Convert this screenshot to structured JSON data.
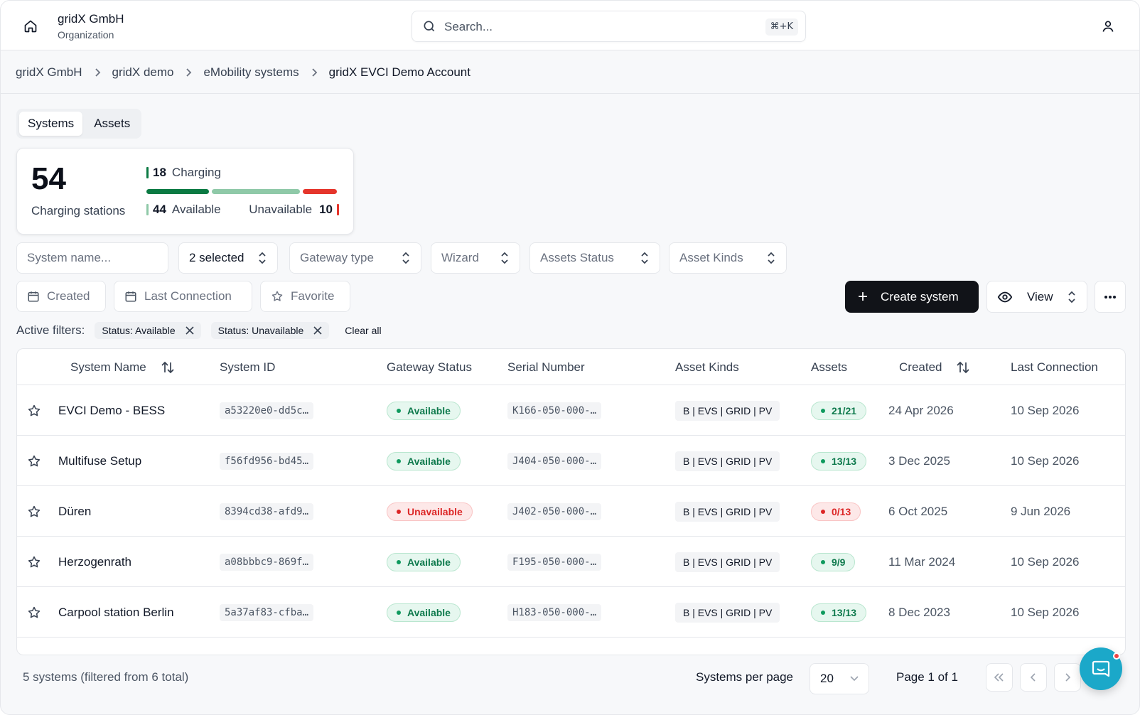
{
  "header": {
    "org_name": "gridX GmbH",
    "org_sub": "Organization",
    "search_placeholder": "Search...",
    "search_shortcut": "⌘+K"
  },
  "breadcrumb": [
    "gridX GmbH",
    "gridX demo",
    "eMobility systems",
    "gridX EVCI Demo Account"
  ],
  "tabs": [
    {
      "label": "Systems",
      "active": true
    },
    {
      "label": "Assets",
      "active": false
    }
  ],
  "stats": {
    "total": "54",
    "total_label": "Charging stations",
    "charging_count": "18",
    "charging_label": "Charging",
    "available_count": "44",
    "available_label": "Available",
    "unavailable_label": "Unavailable",
    "unavailable_count": "10",
    "colors": {
      "charging": "#0b7a43",
      "available": "#8fc9a8",
      "unavailable": "#e5352b"
    }
  },
  "filters": {
    "system_name_placeholder": "System name...",
    "status": "2 selected",
    "gateway_type": "Gateway type",
    "wizard": "Wizard",
    "assets_status": "Assets Status",
    "asset_kinds": "Asset Kinds",
    "created": "Created",
    "last_connection": "Last Connection",
    "favorite": "Favorite"
  },
  "actions": {
    "create_label": "Create system",
    "view_label": "View"
  },
  "active_filters": {
    "label": "Active filters:",
    "chips": [
      "Status: Available",
      "Status: Unavailable"
    ],
    "clear_all": "Clear all"
  },
  "table": {
    "columns": {
      "system_name": "System Name",
      "system_id": "System ID",
      "gateway_status": "Gateway Status",
      "serial_number": "Serial Number",
      "asset_kinds": "Asset Kinds",
      "assets": "Assets",
      "created": "Created",
      "last_connection": "Last Connection"
    },
    "rows": [
      {
        "name": "EVCI Demo - BESS",
        "id": "a53220e0-dd5c…",
        "status": "Available",
        "status_ok": true,
        "serial": "K166-050-000-…",
        "kinds": "B | EVS | GRID | PV",
        "assets": "21/21",
        "assets_ok": true,
        "created": "24 Apr 2026",
        "last": "10 Sep 2026"
      },
      {
        "name": "Multifuse Setup",
        "id": "f56fd956-bd45…",
        "status": "Available",
        "status_ok": true,
        "serial": "J404-050-000-…",
        "kinds": "B | EVS | GRID | PV",
        "assets": "13/13",
        "assets_ok": true,
        "created": "3 Dec 2025",
        "last": "10 Sep 2026"
      },
      {
        "name": "Düren",
        "id": "8394cd38-afd9…",
        "status": "Unavailable",
        "status_ok": false,
        "serial": "J402-050-000-…",
        "kinds": "B | EVS | GRID | PV",
        "assets": "0/13",
        "assets_ok": false,
        "created": "6 Oct 2025",
        "last": "9 Jun 2026"
      },
      {
        "name": "Herzogenrath",
        "id": "a08bbbc9-869f…",
        "status": "Available",
        "status_ok": true,
        "serial": "F195-050-000-…",
        "kinds": "B | EVS | GRID | PV",
        "assets": "9/9",
        "assets_ok": true,
        "created": "11 Mar 2024",
        "last": "10 Sep 2026"
      },
      {
        "name": "Carpool station Berlin",
        "id": "5a37af83-cfba…",
        "status": "Available",
        "status_ok": true,
        "serial": "H183-050-000-…",
        "kinds": "B | EVS | GRID | PV",
        "assets": "13/13",
        "assets_ok": true,
        "created": "8 Dec 2023",
        "last": "10 Sep 2026"
      }
    ]
  },
  "footer": {
    "summary": "5 systems (filtered from 6 total)",
    "per_page_label": "Systems per page",
    "per_page_value": "20",
    "page_info": "Page 1 of 1"
  }
}
